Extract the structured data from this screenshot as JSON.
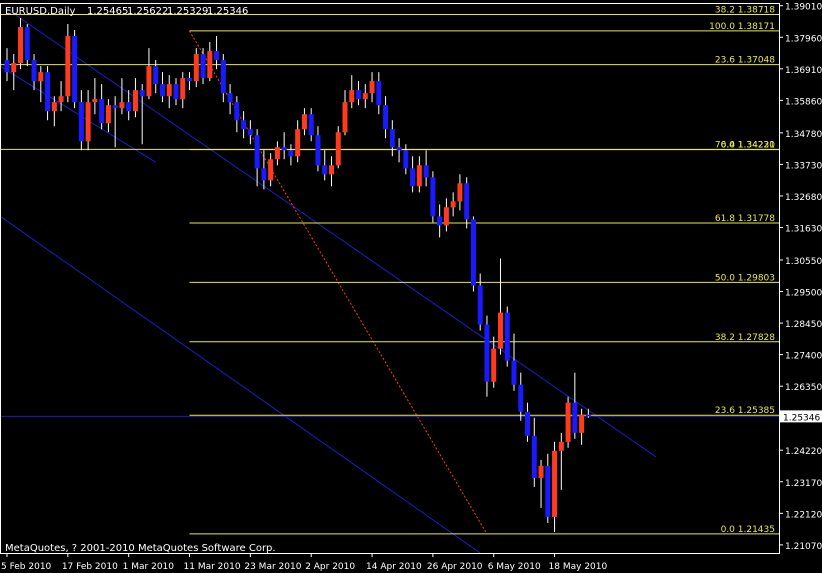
{
  "header": {
    "symbol": "EURUSD,Daily",
    "open": "1.25465",
    "high": "1.25622",
    "low": "1.25329",
    "close": "1.25346"
  },
  "copyright": "MetaQuotes, ? 2001-2010 MetaQuotes Software Corp.",
  "colors": {
    "background": "#000000",
    "frame": "#ffffff",
    "bull": "#ff3b1f",
    "bear": "#1a1aff",
    "wick": "#ffffff",
    "fib": "#e8e84a",
    "channel": "#1c1cc8",
    "trendline": "#ff3b1f",
    "text": "#ffffff"
  },
  "chart_data": {
    "type": "candlestick",
    "symbol": "EURUSD",
    "timeframe": "Daily",
    "ylim": [
      1.208,
      1.391
    ],
    "y_ticks": [
      "1.39010",
      "1.37960",
      "1.36910",
      "1.35860",
      "1.34780",
      "1.33730",
      "1.32680",
      "1.31630",
      "1.30550",
      "1.29500",
      "1.28450",
      "1.27400",
      "1.26350",
      "1.25346",
      "1.24220",
      "1.23170",
      "1.22120",
      "1.21070"
    ],
    "x_ticks": [
      "5 Feb 2010",
      "17 Feb 2010",
      "1 Mar 2010",
      "11 Mar 2010",
      "23 Mar 2010",
      "2 Apr 2010",
      "14 Apr 2010",
      "26 Apr 2010",
      "6 May 2010",
      "18 May 2010"
    ],
    "x_tick_bars": [
      0,
      9,
      18,
      27,
      36,
      45,
      54,
      63,
      72,
      81
    ],
    "bar_count": 87,
    "current_price": 1.25346,
    "candles": [
      [
        1.372,
        1.376,
        1.365,
        1.368
      ],
      [
        1.368,
        1.374,
        1.362,
        1.371
      ],
      [
        1.371,
        1.386,
        1.369,
        1.383
      ],
      [
        1.383,
        1.384,
        1.37,
        1.372
      ],
      [
        1.372,
        1.374,
        1.362,
        1.365
      ],
      [
        1.365,
        1.37,
        1.358,
        1.368
      ],
      [
        1.368,
        1.37,
        1.352,
        1.355
      ],
      [
        1.355,
        1.36,
        1.35,
        1.358
      ],
      [
        1.358,
        1.365,
        1.355,
        1.36
      ],
      [
        1.36,
        1.384,
        1.358,
        1.38
      ],
      [
        1.38,
        1.382,
        1.356,
        1.358
      ],
      [
        1.358,
        1.362,
        1.342,
        1.345
      ],
      [
        1.345,
        1.362,
        1.342,
        1.358
      ],
      [
        1.358,
        1.366,
        1.354,
        1.359
      ],
      [
        1.359,
        1.364,
        1.349,
        1.351
      ],
      [
        1.351,
        1.359,
        1.348,
        1.357
      ],
      [
        1.357,
        1.36,
        1.343,
        1.356
      ],
      [
        1.356,
        1.366,
        1.354,
        1.358
      ],
      [
        1.358,
        1.362,
        1.352,
        1.355
      ],
      [
        1.355,
        1.366,
        1.353,
        1.362
      ],
      [
        1.362,
        1.364,
        1.344,
        1.36
      ],
      [
        1.36,
        1.376,
        1.359,
        1.37
      ],
      [
        1.37,
        1.372,
        1.361,
        1.364
      ],
      [
        1.364,
        1.368,
        1.358,
        1.36
      ],
      [
        1.36,
        1.367,
        1.356,
        1.364
      ],
      [
        1.364,
        1.366,
        1.357,
        1.359
      ],
      [
        1.359,
        1.368,
        1.356,
        1.366
      ],
      [
        1.366,
        1.368,
        1.362,
        1.365
      ],
      [
        1.365,
        1.376,
        1.363,
        1.374
      ],
      [
        1.374,
        1.376,
        1.364,
        1.366
      ],
      [
        1.366,
        1.378,
        1.365,
        1.375
      ],
      [
        1.375,
        1.38,
        1.369,
        1.372
      ],
      [
        1.372,
        1.374,
        1.358,
        1.361
      ],
      [
        1.361,
        1.364,
        1.354,
        1.358
      ],
      [
        1.358,
        1.36,
        1.348,
        1.352
      ],
      [
        1.352,
        1.355,
        1.346,
        1.349
      ],
      [
        1.349,
        1.352,
        1.344,
        1.347
      ],
      [
        1.347,
        1.349,
        1.33,
        1.336
      ],
      [
        1.336,
        1.342,
        1.329,
        1.332
      ],
      [
        1.332,
        1.341,
        1.33,
        1.339
      ],
      [
        1.339,
        1.345,
        1.337,
        1.343
      ],
      [
        1.343,
        1.348,
        1.339,
        1.342
      ],
      [
        1.342,
        1.344,
        1.337,
        1.34
      ],
      [
        1.34,
        1.352,
        1.338,
        1.349
      ],
      [
        1.349,
        1.356,
        1.347,
        1.354
      ],
      [
        1.354,
        1.356,
        1.345,
        1.347
      ],
      [
        1.347,
        1.35,
        1.335,
        1.337
      ],
      [
        1.337,
        1.342,
        1.332,
        1.334
      ],
      [
        1.334,
        1.34,
        1.33,
        1.337
      ],
      [
        1.337,
        1.35,
        1.336,
        1.348
      ],
      [
        1.348,
        1.362,
        1.347,
        1.358
      ],
      [
        1.358,
        1.367,
        1.356,
        1.362
      ],
      [
        1.362,
        1.365,
        1.357,
        1.359
      ],
      [
        1.359,
        1.364,
        1.356,
        1.361
      ],
      [
        1.361,
        1.368,
        1.358,
        1.365
      ],
      [
        1.365,
        1.368,
        1.354,
        1.357
      ],
      [
        1.357,
        1.36,
        1.346,
        1.349
      ],
      [
        1.349,
        1.352,
        1.34,
        1.343
      ],
      [
        1.343,
        1.346,
        1.338,
        1.342
      ],
      [
        1.342,
        1.344,
        1.334,
        1.336
      ],
      [
        1.336,
        1.34,
        1.328,
        1.33
      ],
      [
        1.33,
        1.34,
        1.328,
        1.337
      ],
      [
        1.337,
        1.342,
        1.33,
        1.333
      ],
      [
        1.333,
        1.335,
        1.318,
        1.32
      ],
      [
        1.32,
        1.324,
        1.313,
        1.317
      ],
      [
        1.317,
        1.326,
        1.315,
        1.323
      ],
      [
        1.323,
        1.328,
        1.32,
        1.325
      ],
      [
        1.325,
        1.334,
        1.322,
        1.331
      ],
      [
        1.331,
        1.333,
        1.316,
        1.319
      ],
      [
        1.319,
        1.32,
        1.295,
        1.297
      ],
      [
        1.297,
        1.301,
        1.282,
        1.284
      ],
      [
        1.284,
        1.287,
        1.26,
        1.265
      ],
      [
        1.265,
        1.28,
        1.263,
        1.276
      ],
      [
        1.276,
        1.306,
        1.274,
        1.288
      ],
      [
        1.288,
        1.29,
        1.27,
        1.272
      ],
      [
        1.272,
        1.281,
        1.262,
        1.264
      ],
      [
        1.264,
        1.268,
        1.252,
        1.255
      ],
      [
        1.255,
        1.258,
        1.245,
        1.247
      ],
      [
        1.247,
        1.253,
        1.23,
        1.233
      ],
      [
        1.233,
        1.239,
        1.223,
        1.237
      ],
      [
        1.237,
        1.241,
        1.218,
        1.22
      ],
      [
        1.22,
        1.245,
        1.215,
        1.242
      ],
      [
        1.242,
        1.248,
        1.229,
        1.245
      ],
      [
        1.245,
        1.26,
        1.243,
        1.258
      ],
      [
        1.258,
        1.268,
        1.246,
        1.248
      ],
      [
        1.248,
        1.256,
        1.244,
        1.254
      ],
      [
        1.254,
        1.256,
        1.253,
        1.2535
      ]
    ],
    "fib_levels": [
      {
        "label": "0.0",
        "price": "1.21435"
      },
      {
        "label": "23.6",
        "price": "1.25385"
      },
      {
        "label": "38.2",
        "price": "1.27828"
      },
      {
        "label": "50.0",
        "price": "1.29803"
      },
      {
        "label": "61.8",
        "price": "1.31778"
      },
      {
        "label": "76.4",
        "price": "1.34221"
      },
      {
        "label": "100.0",
        "price": "1.38171"
      },
      {
        "label": "23.6",
        "price": "1.37048"
      },
      {
        "label": "38.2",
        "price": "1.38718"
      },
      {
        "label": "0.0",
        "price": "1.34230"
      }
    ],
    "upper_fib": {
      "high": 1.3901,
      "base": 1.3423,
      "levels": [
        "38.2 1.38718",
        "23.6 1.37048",
        "0.0 1.34230"
      ]
    },
    "channel": {
      "upper": [
        {
          "bar": 0,
          "price": 1.389
        },
        {
          "bar": 96,
          "price": 1.24
        }
      ],
      "lower": [
        {
          "bar": -20,
          "price": 1.35
        },
        {
          "bar": 70,
          "price": 1.208
        }
      ],
      "mid": [
        {
          "bar": -14,
          "price": 1.388
        },
        {
          "bar": 22,
          "price": 1.338
        }
      ]
    },
    "trendline": [
      {
        "bar": 27,
        "price": 1.3817
      },
      {
        "bar": 71,
        "price": 1.2143
      }
    ]
  }
}
